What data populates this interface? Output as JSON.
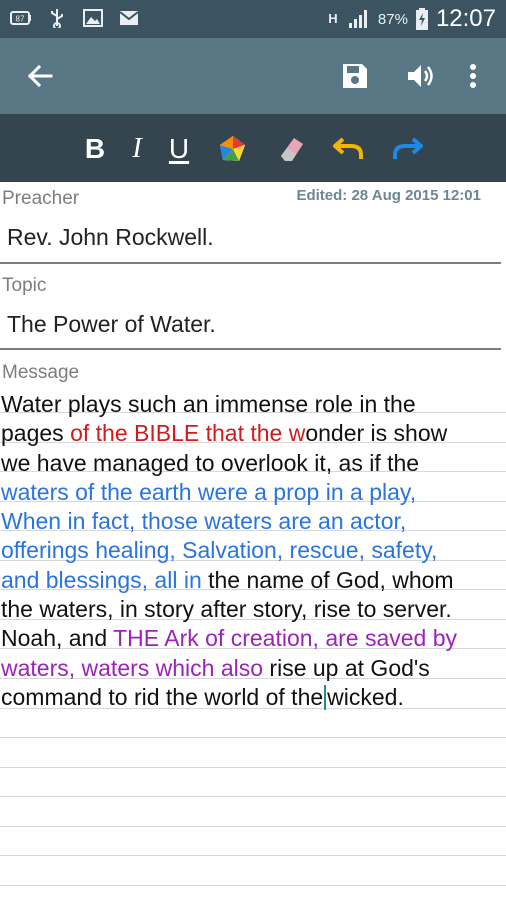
{
  "status_bar": {
    "icons_left": [
      "battery-saver-icon",
      "usb-icon",
      "image-icon",
      "email-icon"
    ],
    "network": "H",
    "battery": "87%",
    "time": "12:07"
  },
  "app_bar": {
    "icons": [
      "back-arrow-icon",
      "save-icon",
      "speaker-icon",
      "overflow-menu-icon"
    ]
  },
  "format_toolbar": {
    "bold": "B",
    "italic": "I",
    "underline": "U",
    "icons": [
      "color-palette-icon",
      "eraser-icon",
      "undo-icon",
      "redo-icon"
    ]
  },
  "edited": "Edited: 28 Aug 2015 12:01",
  "fields": {
    "preacher": {
      "label": "Preacher",
      "value": "Rev. John Rockwell."
    },
    "topic": {
      "label": "Topic",
      "value": "The Power of Water."
    },
    "message": {
      "label": "Message"
    }
  },
  "message": {
    "l1": "Water plays such an immense role in the",
    "l2a": "pages ",
    "l2b": "of the BIBLE that the w",
    "l2c": "onder is show",
    "l3": "we have managed to overlook it, as if the",
    "l4": "waters of the earth were a prop in a play,",
    "l5": "When in fact, those waters are an actor,",
    "l6": "offerings healing, Salvation, rescue, safety,",
    "l7a": "and blessings, all in",
    "l7b": " the name of God, whom",
    "l8": "the waters, in story after story, rise to server.",
    "l9a": "Noah, and ",
    "l9b": "THE Ark of creation, are saved by",
    "l10a": "waters, waters which also",
    "l10b": " rise up at God's",
    "l11a": "command to rid the world of the",
    "l11b": "wicked."
  },
  "colors": {
    "status_bar": "#3c5461",
    "app_bar": "#5a7786",
    "format_bar": "#34454f",
    "red_text": "#d31b1b",
    "blue_text": "#2a74e0",
    "purple_text": "#9c22b8"
  }
}
